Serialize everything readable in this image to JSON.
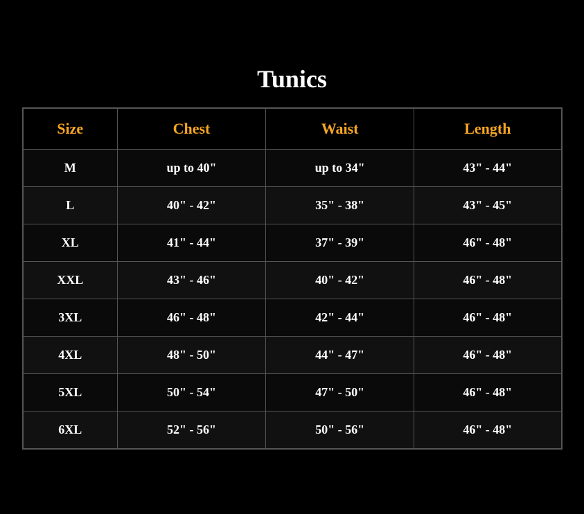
{
  "page": {
    "title": "Tunics",
    "background_color": "#000000"
  },
  "table": {
    "headers": [
      "Size",
      "Chest",
      "Waist",
      "Length"
    ],
    "rows": [
      {
        "size": "M",
        "chest": "up to 40\"",
        "waist": "up to 34\"",
        "length": "43\" - 44\""
      },
      {
        "size": "L",
        "chest": "40\" - 42\"",
        "waist": "35\" - 38\"",
        "length": "43\" - 45\""
      },
      {
        "size": "XL",
        "chest": "41\" - 44\"",
        "waist": "37\" - 39\"",
        "length": "46\" - 48\""
      },
      {
        "size": "XXL",
        "chest": "43\" - 46\"",
        "waist": "40\" - 42\"",
        "length": "46\" - 48\""
      },
      {
        "size": "3XL",
        "chest": "46\" - 48\"",
        "waist": "42\" - 44\"",
        "length": "46\" - 48\""
      },
      {
        "size": "4XL",
        "chest": "48\" - 50\"",
        "waist": "44\" - 47\"",
        "length": "46\" - 48\""
      },
      {
        "size": "5XL",
        "chest": "50\" - 54\"",
        "waist": "47\" - 50\"",
        "length": "46\" - 48\""
      },
      {
        "size": "6XL",
        "chest": "52\" - 56\"",
        "waist": "50\" - 56\"",
        "length": "46\" - 48\""
      }
    ],
    "accent_color": "#f5a623",
    "text_color": "#ffffff"
  }
}
